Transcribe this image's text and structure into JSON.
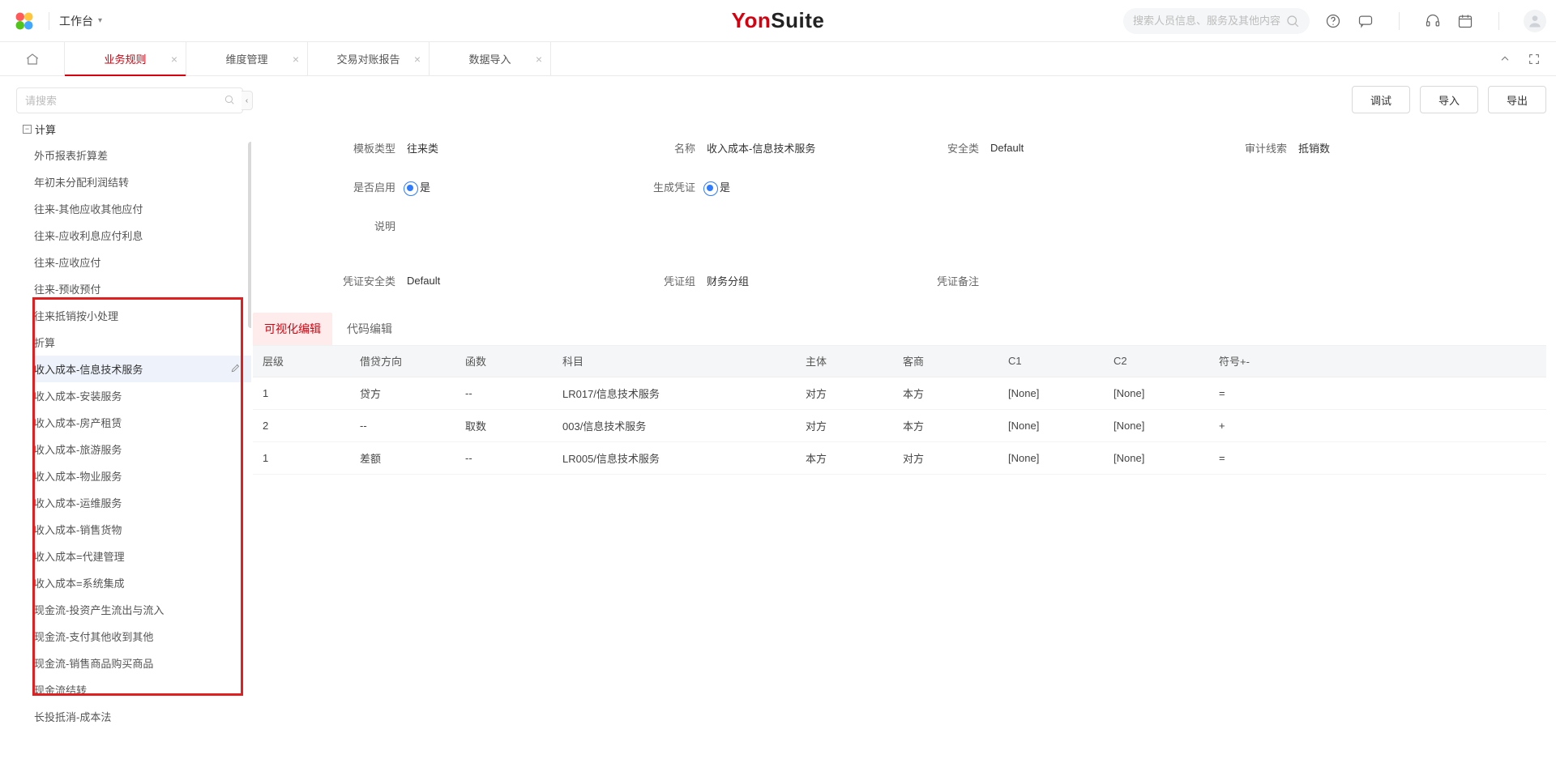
{
  "header": {
    "workspace": "工作台",
    "search_placeholder": "搜索人员信息、服务及其他内容"
  },
  "brand": {
    "left": "Yon",
    "right": "Suite"
  },
  "tabs": [
    {
      "label": "业务规则",
      "active": true
    },
    {
      "label": "维度管理",
      "active": false
    },
    {
      "label": "交易对账报告",
      "active": false
    },
    {
      "label": "数据导入",
      "active": false
    }
  ],
  "left": {
    "search_placeholder": "请搜索",
    "root_label": "计算",
    "items": [
      "外币报表折算差",
      "年初未分配利润结转",
      "往来-其他应收其他应付",
      "往来-应收利息应付利息",
      "往来-应收应付",
      "往来-预收预付",
      "往来抵销按小处理",
      "折算",
      "收入成本-信息技术服务",
      "收入成本-安装服务",
      "收入成本-房产租赁",
      "收入成本-旅游服务",
      "收入成本-物业服务",
      "收入成本-运维服务",
      "收入成本-销售货物",
      "收入成本=代建管理",
      "收入成本=系统集成",
      "现金流-投资产生流出与流入",
      "现金流-支付其他收到其他",
      "现金流-销售商品购买商品",
      "现金流结转",
      "长投抵消-成本法"
    ],
    "selected_index": 8
  },
  "actions": {
    "debug": "调试",
    "import": "导入",
    "export": "导出"
  },
  "form": {
    "row1": {
      "template_type_label": "模板类型",
      "template_type_value": "往来类",
      "name_label": "名称",
      "name_value": "收入成本-信息技术服务",
      "safety_label": "安全类",
      "safety_value": "Default",
      "audit_label": "审计线索",
      "audit_value": "抵销数"
    },
    "row2": {
      "enable_label": "是否启用",
      "enable_value": "是",
      "genvoucher_label": "生成凭证",
      "genvoucher_value": "是"
    },
    "row3": {
      "desc_label": "说明"
    },
    "row4": {
      "vsafety_label": "凭证安全类",
      "vsafety_value": "Default",
      "vgroup_label": "凭证组",
      "vgroup_value": "财务分组",
      "vremark_label": "凭证备注"
    }
  },
  "sub_tabs": {
    "visual": "可视化编辑",
    "code": "代码编辑"
  },
  "table": {
    "headers": [
      "层级",
      "借贷方向",
      "函数",
      "科目",
      "主体",
      "客商",
      "C1",
      "C2",
      "符号+-"
    ],
    "rows": [
      {
        "level": "1",
        "dir": "贷方",
        "func": "--",
        "subject": "LR017/信息技术服务",
        "entity": "对方",
        "partner": "本方",
        "c1": "[None]",
        "c2": "[None]",
        "sign": "="
      },
      {
        "level": "2",
        "dir": "--",
        "func": "取数",
        "subject": "003/信息技术服务",
        "entity": "对方",
        "partner": "本方",
        "c1": "[None]",
        "c2": "[None]",
        "sign": "+"
      },
      {
        "level": "1",
        "dir": "差额",
        "func": "--",
        "subject": "LR005/信息技术服务",
        "entity": "本方",
        "partner": "对方",
        "c1": "[None]",
        "c2": "[None]",
        "sign": "="
      }
    ]
  }
}
